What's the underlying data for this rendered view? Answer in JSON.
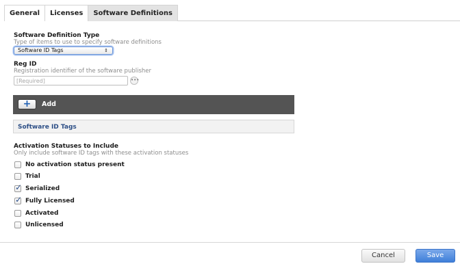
{
  "tabs": [
    {
      "label": "General"
    },
    {
      "label": "Licenses"
    },
    {
      "label": "Software Definitions"
    }
  ],
  "software_definition": {
    "title": "Software Definition Type",
    "description": "Type of items to use to specify software definitions",
    "selected": "Software ID Tags",
    "select_arrows": "⇕"
  },
  "reg_id": {
    "title": "Reg ID",
    "description": "Registration identifier of the software publisher",
    "placeholder": "[Required]",
    "value": ""
  },
  "add_bar": {
    "plus": "+",
    "label": "Add"
  },
  "section": {
    "title": "Software ID Tags"
  },
  "activation": {
    "title": "Activation Statuses to Include",
    "description": "Only include software ID tags with these activation statuses",
    "options": [
      {
        "label": "No activation status present",
        "checked": false
      },
      {
        "label": "Trial",
        "checked": false
      },
      {
        "label": "Serialized",
        "checked": true
      },
      {
        "label": "Fully Licensed",
        "checked": true
      },
      {
        "label": "Activated",
        "checked": false
      },
      {
        "label": "Unlicensed",
        "checked": false
      }
    ]
  },
  "footer": {
    "cancel": "Cancel",
    "save": "Save"
  }
}
